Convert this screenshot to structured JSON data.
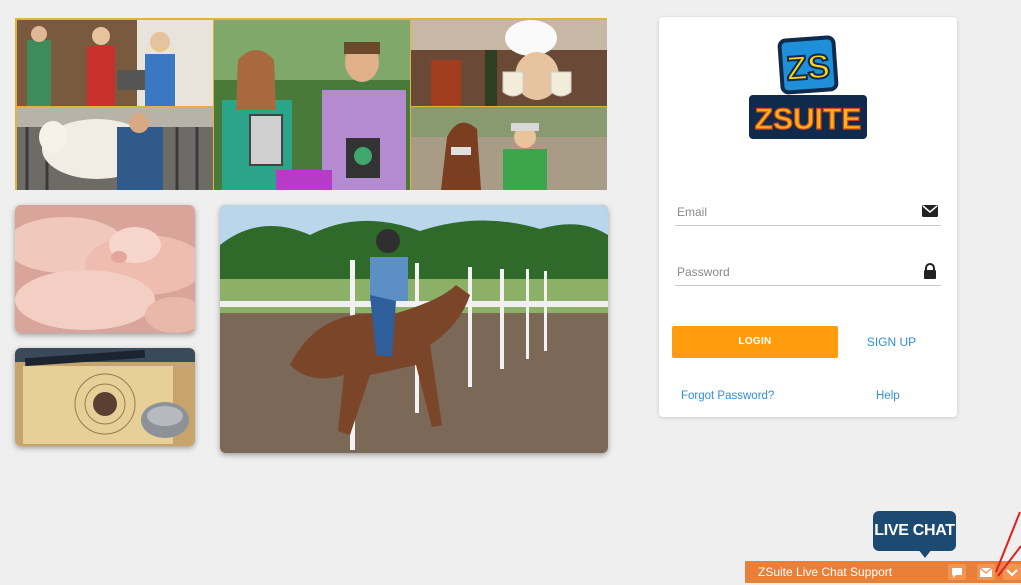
{
  "login": {
    "email_label": "Email",
    "password_label": "Password",
    "login_label": "LOGIN",
    "signup_label": "SIGN UP",
    "forgot_label": "Forgot Password?",
    "help_label": "Help"
  },
  "logo": {
    "monogram": "ZS",
    "wordmark": "ZSUITE"
  },
  "chat": {
    "bubble_label": "LIVE CHAT",
    "bar_title": "ZSuite Live Chat Support"
  },
  "colors": {
    "accent_orange": "#ff9d0e",
    "link_blue": "#2f8fd8",
    "chat_bar": "#e8803a",
    "chat_bubble": "#1c4a72",
    "photo_border": "#e0b43a"
  }
}
